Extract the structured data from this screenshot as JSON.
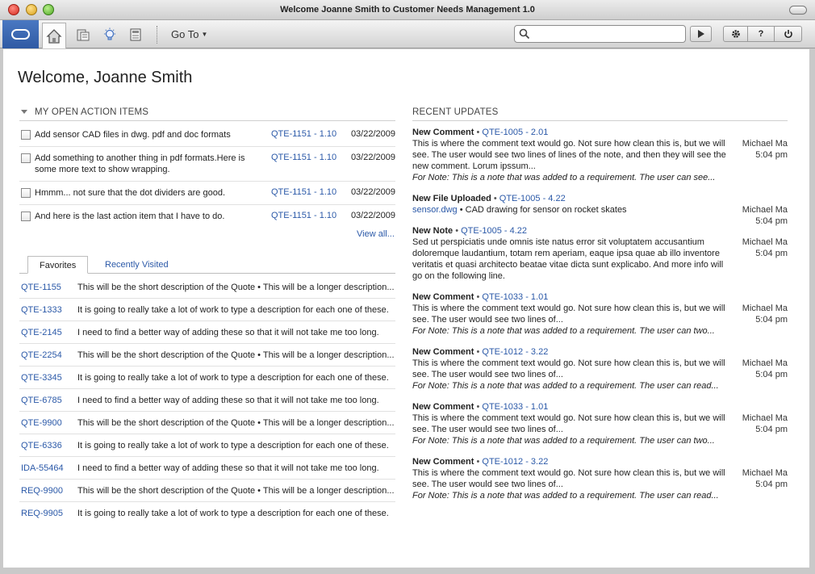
{
  "window": {
    "title": "Welcome Joanne Smith to Customer Needs Management 1.0"
  },
  "toolbar": {
    "goto_label": "Go To",
    "search_placeholder": "",
    "help_label": "?"
  },
  "page": {
    "title": "Welcome, Joanne Smith"
  },
  "action_items": {
    "heading": "MY OPEN ACTION ITEMS",
    "items": [
      {
        "text": "Add sensor CAD files in dwg. pdf and doc formats",
        "ref": "QTE-1151 - 1.10",
        "date": "03/22/2009"
      },
      {
        "text": "Add something to another thing in pdf formats.Here is some more text to show wrapping.",
        "ref": "QTE-1151 - 1.10",
        "date": "03/22/2009"
      },
      {
        "text": "Hmmm... not sure that the dot dividers are good.",
        "ref": "QTE-1151 - 1.10",
        "date": "03/22/2009"
      },
      {
        "text": "And here is the last action item that I have to do.",
        "ref": "QTE-1151 - 1.10",
        "date": "03/22/2009"
      }
    ],
    "view_all": "View all..."
  },
  "tabs": {
    "favorites": "Favorites",
    "recent": "Recently Visited"
  },
  "favorites": [
    {
      "id": "QTE-1155",
      "desc": "This will be the short description of the Quote • This will be a longer description..."
    },
    {
      "id": "QTE-1333",
      "desc": "It is going to really take a lot of work to type a description for each one of these."
    },
    {
      "id": "QTE-2145",
      "desc": "I need to find a better way of adding these so that it will not take me too long."
    },
    {
      "id": "QTE-2254",
      "desc": "This will be the short description of the Quote • This will be a longer description..."
    },
    {
      "id": "QTE-3345",
      "desc": "It is going to really take a lot of work to type a description for each one of these."
    },
    {
      "id": "QTE-6785",
      "desc": "I need to find a better way of adding these so that it will not take me too long."
    },
    {
      "id": "QTE-9900",
      "desc": "This will be the short description of the Quote • This will be a longer description..."
    },
    {
      "id": "QTE-6336",
      "desc": "It is going to really take a lot of work to type a description for each one of these."
    },
    {
      "id": "IDA-55464",
      "desc": "I need to find a better way of adding these so that it will not take me too long."
    },
    {
      "id": "REQ-9900",
      "desc": "This will be the short description of the Quote • This will be a longer description..."
    },
    {
      "id": "REQ-9905",
      "desc": "It is going to really take a lot of work to type a description for each one of these."
    }
  ],
  "updates": {
    "heading": "RECENT UPDATES",
    "items": [
      {
        "kind": "New Comment",
        "ref": "QTE-1005 - 2.01",
        "body": "This is where the comment text would go.  Not sure how clean this is, but we will see.  The user would see two lines of lines of the note, and then they will see the new comment. Lorum ipssum...",
        "note": "For Note: This is a note that was added to a requirement.  The user can see...",
        "author": "Michael Ma",
        "time": "5:04 pm"
      },
      {
        "kind": "New File Uploaded",
        "ref": "QTE-1005 - 4.22",
        "file": "sensor.dwg",
        "file_desc": "CAD drawing for sensor on rocket skates",
        "author": "Michael Ma",
        "time": "5:04 pm"
      },
      {
        "kind": "New Note",
        "ref": "QTE-1005 - 4.22",
        "body": "Sed ut perspiciatis unde omnis iste natus error sit voluptatem accusantium doloremque laudantium, totam rem aperiam, eaque ipsa quae ab illo inventore veritatis et quasi architecto beatae vitae dicta sunt explicabo. And more info will go on the following line.",
        "author": "Michael Ma",
        "time": "5:04 pm"
      },
      {
        "kind": "New Comment",
        "ref": "QTE-1033 - 1.01",
        "body": "This is where the comment text would go.  Not sure how clean this is, but we will see.  The user would see two lines of...",
        "note": "For Note: This is a note that was added to a requirement.  The user can two...",
        "author": "Michael Ma",
        "time": "5:04 pm"
      },
      {
        "kind": "New Comment",
        "ref": "QTE-1012 - 3.22",
        "body": "This is where the comment text would go.  Not sure how clean this is, but we will see.  The user would see two lines of...",
        "note": "For Note: This is a note that was added to a requirement.  The user can read...",
        "author": "Michael Ma",
        "time": "5:04 pm"
      },
      {
        "kind": "New Comment",
        "ref": "QTE-1033 - 1.01",
        "body": "This is where the comment text would go.  Not sure how clean this is, but we will see.  The user would see two lines of...",
        "note": "For Note: This is a note that was added to a requirement.  The user can two...",
        "author": "Michael Ma",
        "time": "5:04 pm"
      },
      {
        "kind": "New Comment",
        "ref": "QTE-1012 - 3.22",
        "body": "This is where the comment text would go.  Not sure how clean this is, but we will see.  The user would see two lines of...",
        "note": "For Note: This is a note that was added to a requirement.  The user can read...",
        "author": "Michael Ma",
        "time": "5:04 pm"
      }
    ]
  },
  "colors": {
    "link": "#2b59a8",
    "brand": "#3563ad"
  }
}
